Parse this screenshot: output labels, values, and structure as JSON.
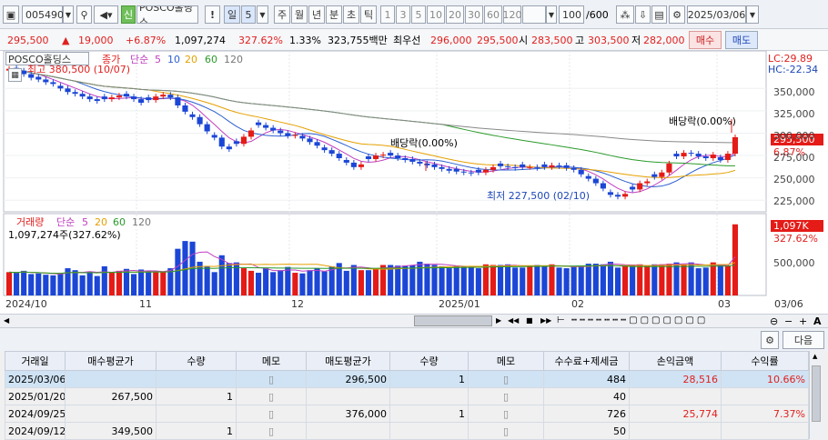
{
  "toolbar": {
    "code": "005490",
    "market": "신",
    "name": "POSCO홀딩스",
    "warn": "!",
    "period": "일",
    "period_n": "5",
    "periods": [
      "주",
      "월",
      "년",
      "분",
      "초",
      "틱"
    ],
    "ticks": [
      "1",
      "3",
      "5",
      "10",
      "20",
      "30",
      "60",
      "120"
    ],
    "count": "100",
    "count_total": "/600",
    "date": "2025/03/06"
  },
  "quote": {
    "price": "295,500",
    "arrow": "▲",
    "change": "19,000",
    "rate": "+6.87%",
    "volume": "1,097,274",
    "vol_ratio": "327.62%",
    "turnover": "1.33%",
    "amount": "323,755백만",
    "best_label": "최우선",
    "best_ask": "296,000",
    "best_bid": "295,500",
    "open_label": "시",
    "open": "283,500",
    "high_label": "고",
    "high": "303,500",
    "low_label": "저",
    "low": "282,000",
    "buy": "매수",
    "sell": "매도"
  },
  "chart": {
    "stock_tab": "POSCO홀딩스",
    "legend_price": [
      "종가",
      "단순",
      "5",
      "10",
      "20",
      "60",
      "120"
    ],
    "legend_vol": [
      "거래량",
      "단순",
      "5",
      "20",
      "60",
      "120"
    ],
    "high_note": "최고 380,500 (10/07)",
    "low_note": "최저 227,500 (02/10)",
    "div1": "배당락(0.00%)",
    "div2": "배당락(0.00%)",
    "lc": "LC:29.89",
    "hc": "HC:-22.34",
    "price_tag": "295,500",
    "pct_tag": "6.87%",
    "vol_tag": "1,097K",
    "vol_pct_tag": "327.62%",
    "vol_value": "1,097,274주(327.62%)",
    "y_labels": [
      "350,000",
      "325,000",
      "300,000",
      "275,000",
      "250,000",
      "225,000"
    ],
    "vol_labels": [
      "500,000"
    ],
    "x_labels": [
      "2024/10",
      "11",
      "12",
      "2025/01",
      "02",
      "03",
      "03/06"
    ]
  },
  "lower": {
    "next": "다음"
  },
  "table": {
    "headers": [
      "거래일",
      "매수평균가",
      "수량",
      "메모",
      "매도평균가",
      "수량",
      "메모",
      "수수료+제세금",
      "손익금액",
      "수익률"
    ],
    "rows": [
      [
        "2025/03/06",
        "",
        "",
        "",
        "296,500",
        "1",
        "",
        "484",
        "28,516",
        "10.66%"
      ],
      [
        "2025/01/20",
        "267,500",
        "1",
        "",
        "",
        "",
        "",
        "40",
        "",
        ""
      ],
      [
        "2024/09/25",
        "",
        "",
        "",
        "376,000",
        "1",
        "",
        "726",
        "25,774",
        "7.37%"
      ],
      [
        "2024/09/12",
        "349,500",
        "1",
        "",
        "",
        "",
        "",
        "50",
        "",
        ""
      ]
    ]
  },
  "colors": {
    "up": "#e41b17",
    "down": "#1b46d6"
  },
  "chart_data": {
    "type": "candlestick",
    "y_range": [
      212000,
      392000
    ],
    "dates": [
      "2024/10",
      "11",
      "12",
      "2025/01",
      "02",
      "03"
    ],
    "close": [
      372000,
      370000,
      366000,
      362000,
      360000,
      357000,
      355000,
      350000,
      346000,
      344000,
      341000,
      338000,
      336000,
      338000,
      340000,
      342000,
      341000,
      338000,
      334000,
      337000,
      341000,
      343000,
      340000,
      331000,
      324000,
      318000,
      310000,
      302000,
      295000,
      285000,
      282000,
      288000,
      296000,
      303000,
      309000,
      306000,
      303000,
      300000,
      297000,
      298000,
      294000,
      290000,
      286000,
      281000,
      277000,
      272000,
      267000,
      262000,
      265000,
      271000,
      275000,
      276000,
      275000,
      272000,
      270000,
      268000,
      266000,
      264000,
      262000,
      260000,
      258000,
      257000,
      256000,
      255000,
      256000,
      259000,
      262000,
      263000,
      262000,
      261000,
      262000,
      262000,
      261000,
      262000,
      264000,
      263000,
      261000,
      259000,
      254000,
      249000,
      244000,
      238000,
      231000,
      229000,
      232000,
      237000,
      244000,
      246000,
      251000,
      256000,
      266000,
      274000,
      278000,
      277000,
      274000,
      272000,
      276000,
      270000,
      277000,
      295500
    ],
    "volume": [
      360000,
      350000,
      380000,
      330000,
      340000,
      320000,
      310000,
      350000,
      420000,
      390000,
      310000,
      370000,
      300000,
      450000,
      360000,
      380000,
      410000,
      330000,
      400000,
      380000,
      370000,
      360000,
      420000,
      720000,
      840000,
      830000,
      520000,
      450000,
      360000,
      620000,
      500000,
      510000,
      420000,
      380000,
      350000,
      420000,
      360000,
      390000,
      440000,
      350000,
      340000,
      390000,
      420000,
      370000,
      450000,
      500000,
      380000,
      470000,
      390000,
      390000,
      420000,
      470000,
      470000,
      460000,
      460000,
      470000,
      520000,
      490000,
      470000,
      450000,
      420000,
      460000,
      450000,
      430000,
      420000,
      480000,
      470000,
      470000,
      480000,
      430000,
      430000,
      460000,
      470000,
      450000,
      480000,
      430000,
      420000,
      440000,
      460000,
      490000,
      490000,
      480000,
      520000,
      430000,
      450000,
      470000,
      480000,
      460000,
      480000,
      480000,
      490000,
      510000,
      480000,
      510000,
      420000,
      430000,
      510000,
      480000,
      460000,
      1097274
    ]
  }
}
